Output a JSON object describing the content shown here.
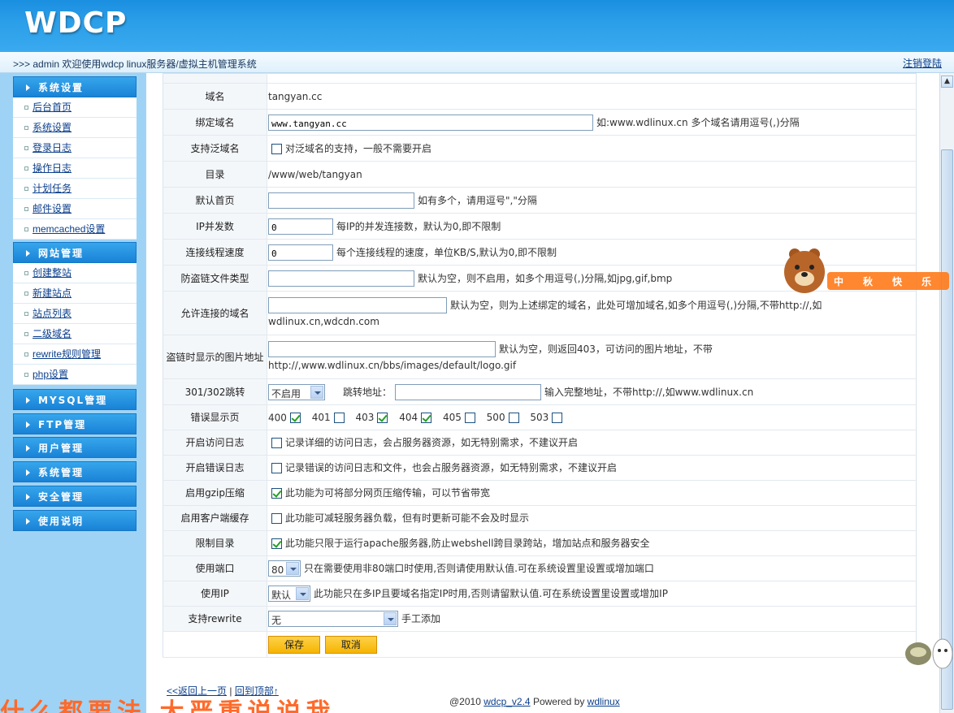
{
  "header": {
    "logo": "WDCP",
    "welcome": ">>> admin 欢迎使用wdcp linux服务器/虚拟主机管理系统",
    "logout": "注销登陆"
  },
  "sidebar": {
    "groups": [
      {
        "title": "系统设置",
        "items": [
          "后台首页",
          "系统设置",
          "登录日志",
          "操作日志",
          "计划任务",
          "邮件设置",
          "memcached设置"
        ]
      },
      {
        "title": "网站管理",
        "items": [
          "创建整站",
          "新建站点",
          "站点列表",
          "二级域名",
          "rewrite规则管理",
          "php设置"
        ]
      },
      {
        "title": "MYSQL管理",
        "items": []
      },
      {
        "title": "FTP管理",
        "items": []
      },
      {
        "title": "用户管理",
        "items": []
      },
      {
        "title": "系统管理",
        "items": []
      },
      {
        "title": "安全管理",
        "items": []
      },
      {
        "title": "使用说明",
        "items": []
      }
    ]
  },
  "form": {
    "domain": {
      "label": "域名",
      "value": "tangyan.cc"
    },
    "bind_domain": {
      "label": "绑定域名",
      "value": "www.tangyan.cc",
      "hint": "如:www.wdlinux.cn 多个域名请用逗号(,)分隔"
    },
    "wildcard": {
      "label": "支持泛域名",
      "hint": "对泛域名的支持，一般不需要开启"
    },
    "directory": {
      "label": "目录",
      "value": "/www/web/tangyan"
    },
    "default_page": {
      "label": "默认首页",
      "value": "",
      "hint": "如有多个，请用逗号\",\"分隔"
    },
    "ip_concurrency": {
      "label": "IP并发数",
      "value": "0",
      "hint": "每IP的并发连接数，默认为0,即不限制"
    },
    "thread_speed": {
      "label": "连接线程速度",
      "value": "0",
      "hint": "每个连接线程的速度，单位KB/S,默认为0,即不限制"
    },
    "hotlink_types": {
      "label": "防盗链文件类型",
      "value": "",
      "hint": "默认为空，则不启用，如多个用逗号(,)分隔,如jpg,gif,bmp"
    },
    "allowed_domains": {
      "label": "允许连接的域名",
      "value": "",
      "hint": "默认为空，则为上述绑定的域名，此处可增加域名,如多个用逗号(,)分隔,不带http://,如",
      "hint2": "wdlinux.cn,wdcdn.com"
    },
    "hotlink_image": {
      "label": "盗链时显示的图片地址",
      "value": "",
      "hint": "默认为空，则返回403，可访问的图片地址，不带",
      "hint2": "http://,www.wdlinux.cn/bbs/images/default/logo.gif"
    },
    "redirect": {
      "label": "301/302跳转",
      "select": "不启用",
      "addr_label": "跳转地址：",
      "value": "",
      "hint": "输入完整地址，不带http://,如www.wdlinux.cn"
    },
    "error_pages": {
      "label": "错误显示页",
      "codes": [
        {
          "code": "400",
          "checked": true
        },
        {
          "code": "401",
          "checked": false
        },
        {
          "code": "403",
          "checked": true
        },
        {
          "code": "404",
          "checked": true
        },
        {
          "code": "405",
          "checked": false
        },
        {
          "code": "500",
          "checked": false
        },
        {
          "code": "503",
          "checked": false
        }
      ]
    },
    "access_log": {
      "label": "开启访问日志",
      "hint": "记录详细的访问日志，会占服务器资源，如无特别需求，不建议开启"
    },
    "error_log": {
      "label": "开启错误日志",
      "hint": "记录错误的访问日志和文件，也会占服务器资源，如无特别需求，不建议开启"
    },
    "gzip": {
      "label": "启用gzip压缩",
      "hint": "此功能为可将部分网页压缩传输，可以节省带宽"
    },
    "client_cache": {
      "label": "启用客户端缓存",
      "hint": "此功能可减轻服务器负载，但有时更新可能不会及时显示"
    },
    "limit_dir": {
      "label": "限制目录",
      "hint": "此功能只限于运行apache服务器,防止webshell跨目录跨站，增加站点和服务器安全"
    },
    "port": {
      "label": "使用端口",
      "select": "80",
      "hint": "只在需要使用非80端口时使用,否则请使用默认值.可在系统设置里设置或增加端口"
    },
    "ip": {
      "label": "使用IP",
      "select": "默认",
      "hint": "此功能只在多IP且要域名指定IP时用,否则请留默认值.可在系统设置里设置或增加IP"
    },
    "rewrite": {
      "label": "支持rewrite",
      "select": "无",
      "hint": "手工添加"
    },
    "save": "保存",
    "cancel": "取消"
  },
  "footer": {
    "back": "<<返回上一页",
    "sep": "|",
    "top": "回到顶部↑",
    "copyright_prefix": "@2010",
    "version": "wdcp_v2.4",
    "powered": "Powered by",
    "brand": "wdlinux"
  },
  "mascot": {
    "badges": [
      "中",
      "秋",
      "快",
      "乐"
    ]
  },
  "overlay": {
    "text": "什么都要法 大严重说说我"
  }
}
